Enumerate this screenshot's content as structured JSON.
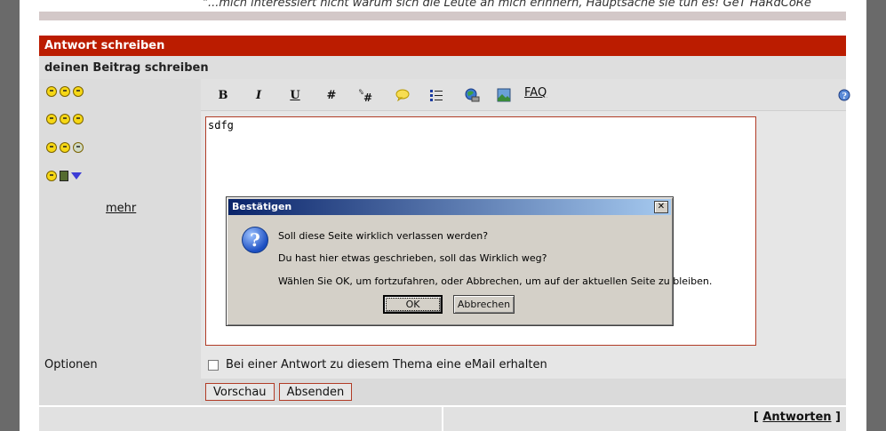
{
  "quote": "\"...mich interessiert nicht warum sich die Leute an mich erinnern, Hauptsache sie tun es! GeT HaRdCoRe",
  "title": "Antwort schreiben",
  "subtitle": "deinen Beitrag schreiben",
  "toolbar": {
    "bold": "B",
    "italic": "I",
    "underline": "U",
    "hash": "#",
    "faq": "FAQ"
  },
  "smilies": {
    "more_label": "mehr"
  },
  "editor": {
    "value": "sdfg"
  },
  "options": {
    "label": "Optionen",
    "notify_label": "Bei einer Antwort zu diesem Thema eine eMail erhalten"
  },
  "buttons": {
    "preview": "Vorschau",
    "submit": "Absenden"
  },
  "footer": {
    "bracket_open": "[",
    "reply_link": "Antworten",
    "bracket_close": "]"
  },
  "dialog": {
    "title": "Bestätigen",
    "close": "✕",
    "line1": "Soll diese Seite wirklich verlassen werden?",
    "line2": "Du hast hier etwas geschrieben, soll das Wirklich weg?",
    "line3": "Wählen Sie OK, um fortzufahren, oder Abbrechen, um auf der aktuellen Seite zu bleiben.",
    "ok": "OK",
    "cancel": "Abbrechen"
  },
  "colors": {
    "header_red": "#bb1c00",
    "dialog_title_blue": "#0a246a",
    "input_border": "#b13c26"
  }
}
